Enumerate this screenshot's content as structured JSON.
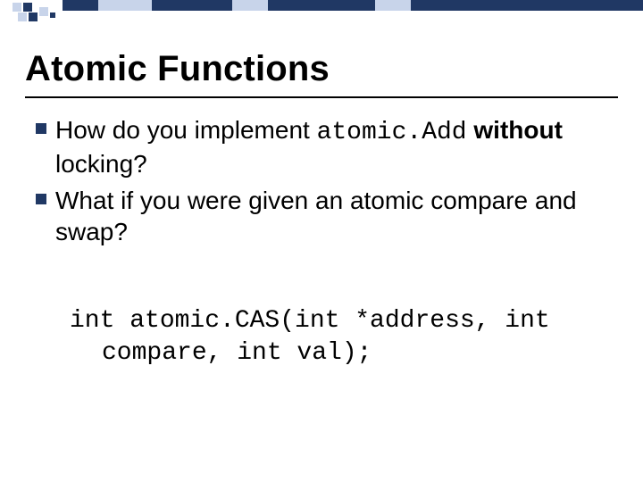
{
  "title": "Atomic Functions",
  "bullets": [
    {
      "pre": "How do you implement ",
      "code": "atomic.Add",
      "mid": " ",
      "bold": "without",
      "post": " locking?"
    },
    {
      "pre": "What if you were given an atomic compare and swap?",
      "code": "",
      "mid": "",
      "bold": "",
      "post": ""
    }
  ],
  "code": {
    "line1": "int atomic.CAS(int *address, int",
    "line2": "compare, int val);"
  },
  "colors": {
    "accent_dark": "#203864",
    "accent_light": "#c8d4ea"
  }
}
